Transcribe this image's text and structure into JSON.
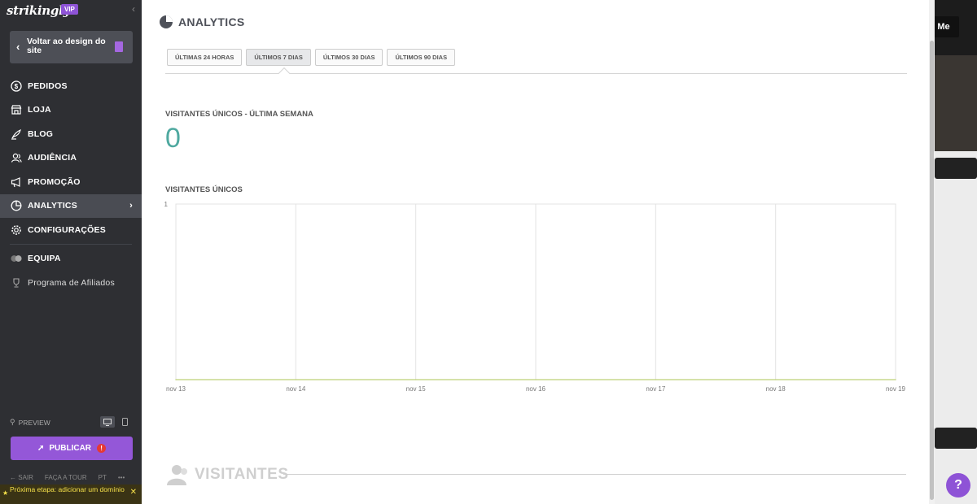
{
  "sidebar": {
    "logo": "strikingly",
    "vip": "VIP",
    "back_label": "Voltar ao design do site",
    "items": [
      {
        "label": "PEDIDOS",
        "icon": "dollar-icon"
      },
      {
        "label": "LOJA",
        "icon": "store-icon"
      },
      {
        "label": "BLOG",
        "icon": "quill-icon"
      },
      {
        "label": "AUDIÊNCIA",
        "icon": "users-icon"
      },
      {
        "label": "PROMOÇÃO",
        "icon": "megaphone-icon"
      },
      {
        "label": "ANALYTICS",
        "icon": "pie-chart-icon"
      },
      {
        "label": "CONFIGURAÇÕES",
        "icon": "gear-icon"
      },
      {
        "label": "EQUIPA",
        "icon": "team-icon"
      },
      {
        "label": "Programa de Afiliados",
        "icon": "trophy-icon"
      }
    ],
    "preview_label": "PREVIEW",
    "publish_label": "PUBLICAR",
    "publish_warning": "!",
    "links": [
      "SAIR",
      "FAÇA A TOUR",
      "PT",
      "•••"
    ],
    "next_step": "Próxima etapa: adicionar um domínio"
  },
  "main": {
    "title": "ANALYTICS",
    "tabs": [
      "ÚLTIMAS 24 HORAS",
      "ÚLTIMOS 7 DIAS",
      "ÚLTIMOS 30 DIAS",
      "ÚLTIMOS 90 DIAS"
    ],
    "active_tab": "ÚLTIMOS 7 DIAS",
    "metric_label": "VISITANTES ÚNICOS - ÚLTIMA SEMANA",
    "metric_value": "0",
    "chart_label": "VISITANTES ÚNICOS",
    "visitors_section": "VISITANTES"
  },
  "background": {
    "me_button": "Me"
  },
  "help_label": "?",
  "colors": {
    "accent": "#9457d8",
    "metric": "#4fa9a0",
    "line": "#c9d88e"
  },
  "chart_data": {
    "type": "line",
    "categories": [
      "nov 13",
      "nov 14",
      "nov 15",
      "nov 16",
      "nov 17",
      "nov 18",
      "nov 19"
    ],
    "series": [
      {
        "values": [
          0,
          0,
          0,
          0,
          0,
          0,
          0
        ]
      }
    ],
    "ylim": [
      0,
      1
    ],
    "ytick_labels": [
      "1"
    ],
    "grid": true
  }
}
